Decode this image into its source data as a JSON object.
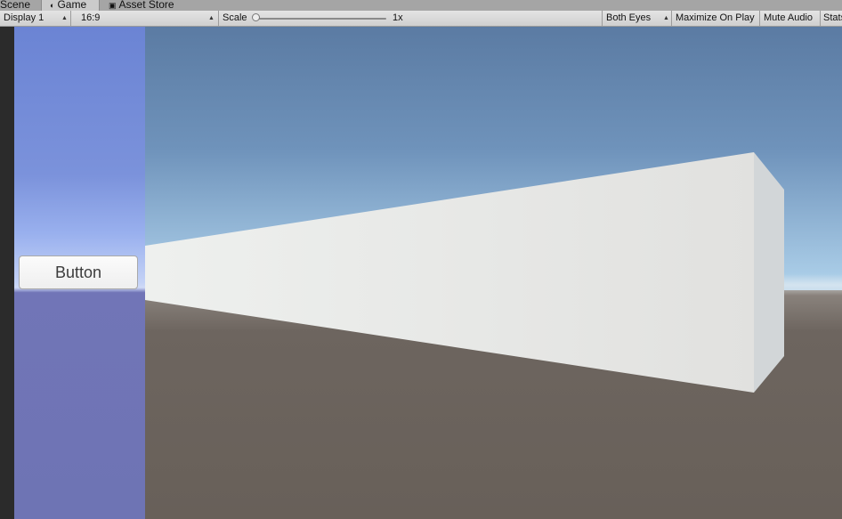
{
  "tabs": [
    {
      "label": "Scene",
      "icon": "scene-icon"
    },
    {
      "label": "Game",
      "icon": "game-controller-icon"
    },
    {
      "label": "Asset Store",
      "icon": "shopping-bag-icon"
    }
  ],
  "toolbar": {
    "display": "Display 1",
    "aspect": "16:9",
    "scale_label": "Scale",
    "scale_value": "1x",
    "eyes": "Both Eyes",
    "maximize": "Maximize On Play",
    "mute": "Mute Audio",
    "stats": "Stats"
  },
  "game": {
    "button_label": "Button"
  },
  "colors": {
    "sky_top": "#5b7ba3",
    "ground": "#686059",
    "panel": "#6e74b4",
    "cube": "#e6e6e4"
  }
}
